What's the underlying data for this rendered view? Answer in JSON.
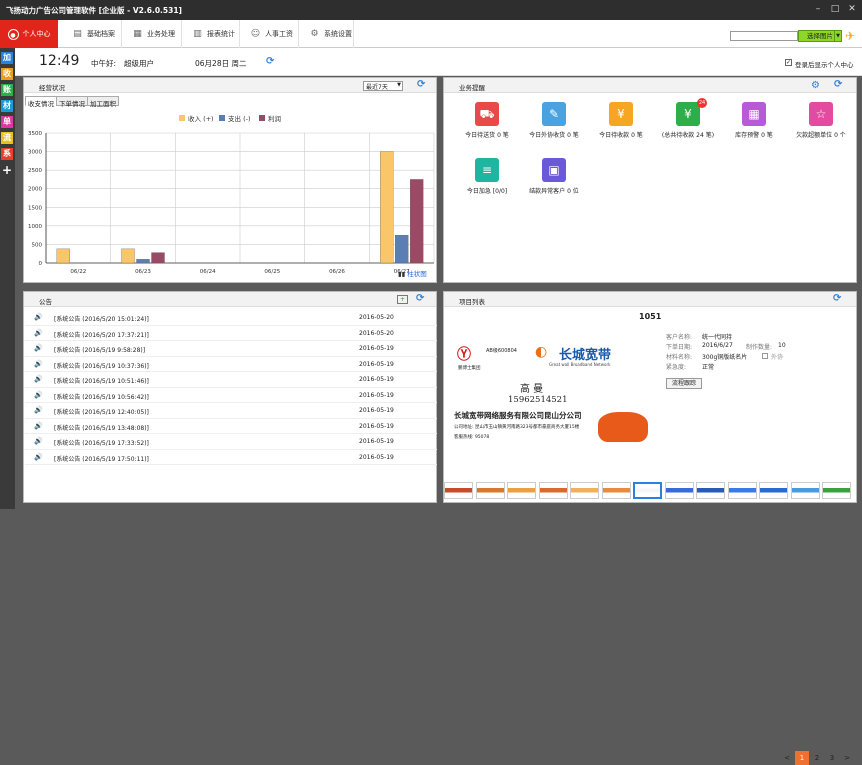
{
  "titlebar": {
    "title": "飞扬动力广告公司管理软件 [企业版 - V2.6.0.531]"
  },
  "nav": {
    "items": [
      "个人中心",
      "基础档案",
      "业务处理",
      "报表统计",
      "人事工资",
      "系统设置"
    ]
  },
  "search": {
    "button": "选择图片",
    "value": ""
  },
  "sidebar": {
    "items": [
      "加",
      "收",
      "账",
      "材",
      "单",
      "流",
      "系",
      "+"
    ]
  },
  "info": {
    "time": "12:49",
    "greeting": "中午好:",
    "user": "超级用户",
    "date": "06月28日 周二",
    "show_after_login": "登录后显示个人中心"
  },
  "business_status": {
    "title": "经营状况",
    "range": "最近7天",
    "tabs": [
      "收支情况",
      "下单情况",
      "加工面积"
    ],
    "chart_link": "柱状图"
  },
  "chart_data": {
    "type": "bar",
    "categories": [
      "06/22",
      "06/23",
      "06/24",
      "06/25",
      "06/26",
      "06/27"
    ],
    "series": [
      {
        "name": "收入 (+)",
        "color": "#f9c66a",
        "values": [
          380,
          380,
          0,
          0,
          0,
          3000
        ]
      },
      {
        "name": "支出 (-)",
        "color": "#5b7fb5",
        "values": [
          0,
          100,
          0,
          0,
          0,
          750
        ]
      },
      {
        "name": "利润",
        "color": "#9b4a66",
        "values": [
          0,
          280,
          0,
          0,
          0,
          2250
        ]
      }
    ],
    "ylim": [
      0,
      3500
    ],
    "yticks": [
      0,
      500,
      1000,
      1500,
      2000,
      2500,
      3000,
      3500
    ],
    "legend": "top-center",
    "grid": true
  },
  "business_tips": {
    "title": "业务提醒",
    "tiles": [
      {
        "label": "今日待送货 0 笔",
        "color": "#e84a4a",
        "icon": "truck-icon",
        "glyph": "⛟"
      },
      {
        "label": "今日外协收货 0 笔",
        "color": "#4aa3e0",
        "icon": "edit-icon",
        "glyph": "✎"
      },
      {
        "label": "今日待收款 0 笔",
        "color": "#f5a623",
        "icon": "money-bag-icon",
        "glyph": "¥"
      },
      {
        "label": "(总共待收款 24 笔)",
        "color": "#2eae4a",
        "icon": "yen-icon",
        "glyph": "¥",
        "badge": "24"
      },
      {
        "label": "库存预警 0 笔",
        "color": "#b85ad8",
        "icon": "warehouse-icon",
        "glyph": "▦"
      },
      {
        "label": "欠款超额单位 0 个",
        "color": "#e34ba0",
        "icon": "star-icon",
        "glyph": "☆"
      },
      {
        "label": "今日加急 [0/0]",
        "color": "#1fb5a0",
        "icon": "list-icon",
        "glyph": "≡"
      },
      {
        "label": "结款异常客户 0 位",
        "color": "#6a5ad8",
        "icon": "calendar-icon",
        "glyph": "▣"
      }
    ]
  },
  "announcements": {
    "title": "公告",
    "rows": [
      {
        "text": "[系统公告 (2016/5/20 15:01:24)]",
        "date": "2016-05-20"
      },
      {
        "text": "[系统公告 (2016/5/20 17:37:21)]",
        "date": "2016-05-20"
      },
      {
        "text": "[系统公告 (2016/5/19 9:58:28)]",
        "date": "2016-05-19"
      },
      {
        "text": "[系统公告 (2016/5/19 10:37:36)]",
        "date": "2016-05-19"
      },
      {
        "text": "[系统公告 (2016/5/19 10:51:46)]",
        "date": "2016-05-19"
      },
      {
        "text": "[系统公告 (2016/5/19 10:56:42)]",
        "date": "2016-05-19"
      },
      {
        "text": "[系统公告 (2016/5/19 12:40:05)]",
        "date": "2016-05-19"
      },
      {
        "text": "[系统公告 (2016/5/19 13:48:08)]",
        "date": "2016-05-19"
      },
      {
        "text": "[系统公告 (2016/5/19 17:33:52)]",
        "date": "2016-05-19"
      },
      {
        "text": "[系统公告 (2016/5/19 17:50:11)]",
        "date": "2016-05-19"
      }
    ]
  },
  "projects": {
    "title": "项目列表",
    "id": "1051",
    "card": {
      "brand_left": "AB级600804",
      "brand_left_sub": "鹏博士集团",
      "brand_main": "长城宽带",
      "brand_sub": "Great wall Broadband Network",
      "name": "高 曼",
      "phone": "15962514521",
      "company": "长城宽带网络服务有限公司昆山分公司",
      "address": "公司地址: 昆山市玉山镇黄河南路323号都市豪庭商务大厦15楼",
      "hotline": "客服热线: 95078"
    },
    "fields": [
      {
        "label": "客户名称:",
        "value": "统一代同持"
      },
      {
        "label": "下单日期:",
        "value": "2016/6/27",
        "label2": "制作数量:",
        "value2": "10"
      },
      {
        "label": "材料名称:",
        "value": "300g铜版纸名片",
        "check": "外协"
      },
      {
        "label": "紧急度:",
        "value": "正常"
      }
    ],
    "track_button": "流程跟踪",
    "pagination": {
      "prev": "<",
      "pages": [
        "1",
        "2",
        "3"
      ],
      "next": ">",
      "current": "1"
    }
  }
}
